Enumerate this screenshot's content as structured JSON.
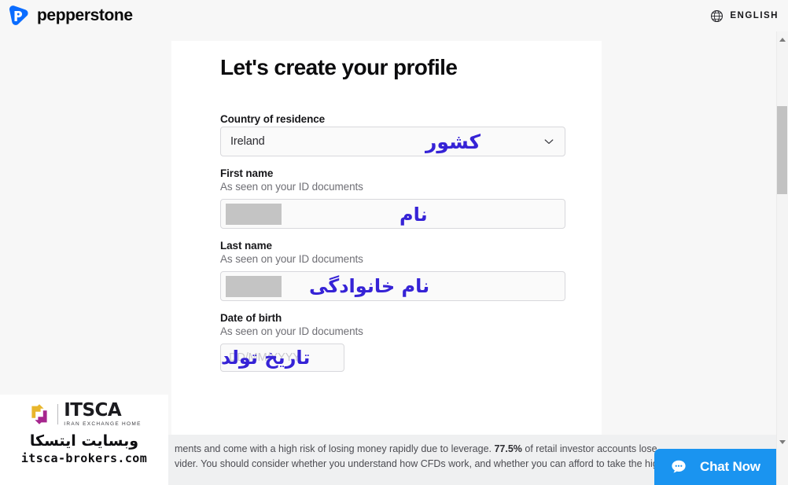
{
  "header": {
    "brand_name": "pepperstone",
    "brand_icon": "pepperstone-logo-icon",
    "language_label": "ENGLISH",
    "globe_icon": "globe-icon"
  },
  "form": {
    "title": "Let's create your profile",
    "fields": [
      {
        "key": "country",
        "label": "Country of residence",
        "hint": "",
        "type": "select",
        "value": "Ireland",
        "placeholder": "",
        "annotation_fa": "کشور",
        "annotation_color": "#3623d6",
        "chevron_icon": "chevron-down-icon"
      },
      {
        "key": "first_name",
        "label": "First name",
        "hint": "As seen on your ID documents",
        "type": "text",
        "value": "",
        "placeholder": "",
        "redacted": true,
        "annotation_fa": "نام",
        "annotation_color": "#3623d6"
      },
      {
        "key": "last_name",
        "label": "Last name",
        "hint": "As seen on your ID documents",
        "type": "text",
        "value": "",
        "placeholder": "",
        "redacted": true,
        "annotation_fa": "نام خانوادگی",
        "annotation_color": "#3623d6"
      },
      {
        "key": "date_of_birth",
        "label": "Date of birth",
        "hint": "As seen on your ID documents",
        "type": "date",
        "value": "",
        "placeholder": "DD/MM/YYYY",
        "annotation_fa": "تاریخ تولد",
        "annotation_color": "#3623d6"
      }
    ]
  },
  "disclaimer": {
    "line1_a": "ments and come with a high risk of losing money rapidly due to leverage. ",
    "line1_b": "77.5%",
    "line1_c": " of retail investor accounts lose",
    "line2": "vider. You should consider whether you understand how CFDs work, and whether you can afford to take the high"
  },
  "watermark": {
    "logo_icon": "itsca-arrow-logo-icon",
    "name": "ITSCA",
    "subtitle": "IRAN EXCHANGE HOME",
    "persian_text": "وبسایت ایتسکا",
    "url": "itsca-brokers.com",
    "accent_yellow": "#e8b62c",
    "accent_purple": "#a6268e"
  },
  "chat": {
    "label": "Chat Now",
    "icon": "chat-bubble-icon",
    "background": "#1a94f0"
  },
  "scrollbar": {
    "up_arrow_icon": "scroll-up-arrow-icon",
    "down_arrow_icon": "scroll-down-arrow-icon"
  }
}
